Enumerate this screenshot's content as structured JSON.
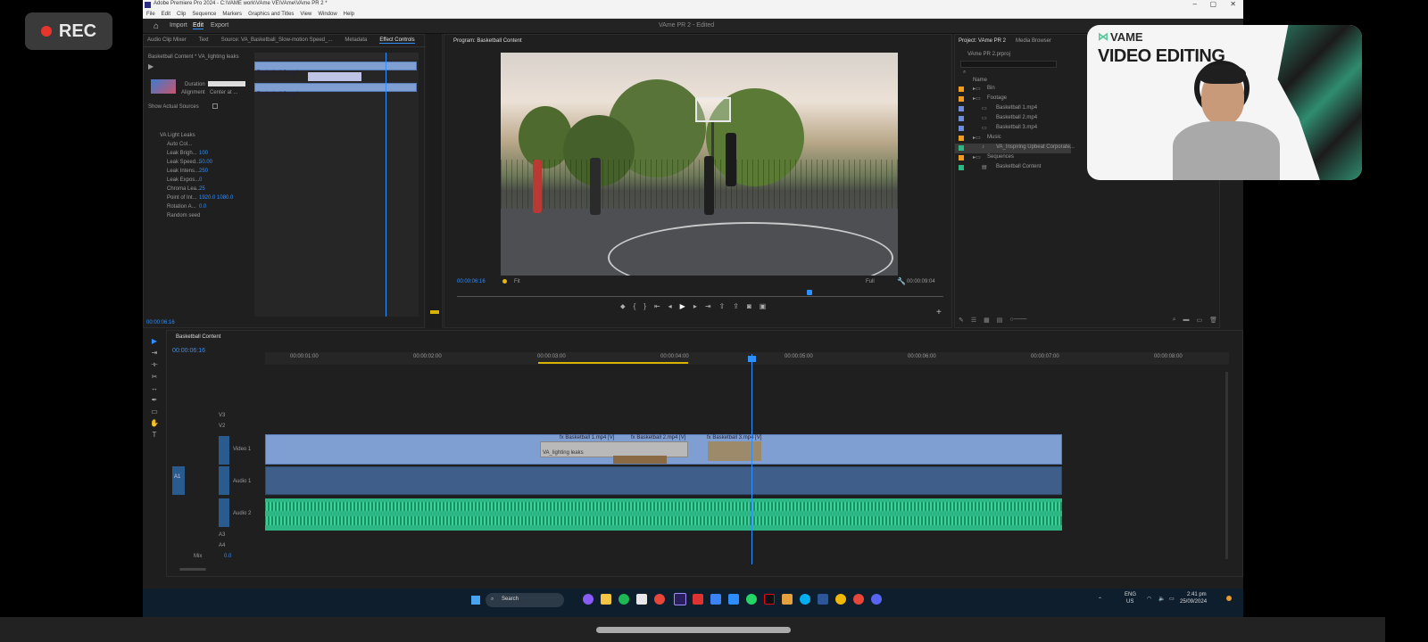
{
  "recorder": {
    "label": "REC"
  },
  "window": {
    "title": "Adobe Premiere Pro 2024 - C:\\VAME work\\VAme VE\\VAme\\VAme PR 2 *",
    "center_title": "VAme PR 2 - Edited"
  },
  "menu": [
    "File",
    "Edit",
    "Clip",
    "Sequence",
    "Markers",
    "Graphics and Titles",
    "View",
    "Window",
    "Help"
  ],
  "workspace_tabs": [
    "Import",
    "Edit",
    "Export"
  ],
  "source_tabs": [
    "Audio Clip Mixer",
    "Text",
    "Source: VA_Basketball_Slow-motion Speed_...",
    "Metadata",
    "Effect Controls"
  ],
  "effect_controls": {
    "header": "Basketball Content * VA_lighting leaks",
    "clips": [
      "Basketball 2.mp4",
      "Basketball 2.mp4"
    ],
    "duration_label": "Duration",
    "alignment_label": "Alignment",
    "alignment_value": "Center at ...",
    "show_actual_sources": "Show Actual Sources",
    "fx_title": "VA Light Leaks",
    "params": [
      {
        "name": "Auto Col...",
        "value": ""
      },
      {
        "name": "Leak Brigh...",
        "value": "100"
      },
      {
        "name": "Leak Speed...",
        "value": "50.00"
      },
      {
        "name": "Leak Intens...",
        "value": "250"
      },
      {
        "name": "Leak Expos...",
        "value": "0"
      },
      {
        "name": "Chroma Lea...",
        "value": "25"
      },
      {
        "name": "Point of Int...",
        "value": "1920.0   1080.0"
      },
      {
        "name": "Rotation A...",
        "value": "0.0"
      },
      {
        "name": "Random seed",
        "value": ""
      }
    ],
    "timecode": "00:00:06:16"
  },
  "program": {
    "tab": "Program: Basketball Content",
    "timecode": "00:00:06:16",
    "fit": "Fit",
    "quality": "Full",
    "duration": "00:00:09:04"
  },
  "project": {
    "tabs": [
      "Project: VAme PR 2",
      "Media Browser"
    ],
    "path": "VAme PR 2.prproj",
    "col_name": "Name",
    "items": [
      {
        "name": "Bin",
        "color": "#f39b1f",
        "indent": 1,
        "type": "bin"
      },
      {
        "name": "Footage",
        "color": "#f39b1f",
        "indent": 1,
        "type": "bin"
      },
      {
        "name": "Basketball 1.mp4",
        "color": "#6d8ed6",
        "indent": 2,
        "type": "clip"
      },
      {
        "name": "Basketball 2.mp4",
        "color": "#6d8ed6",
        "indent": 2,
        "type": "clip"
      },
      {
        "name": "Basketball 3.mp4",
        "color": "#6d8ed6",
        "indent": 2,
        "type": "clip"
      },
      {
        "name": "Music",
        "color": "#f39b1f",
        "indent": 1,
        "type": "bin"
      },
      {
        "name": "VA_Inspiring Upbeat Corporate...",
        "color": "#2db785",
        "indent": 2,
        "type": "audio",
        "selected": true
      },
      {
        "name": "Sequences",
        "color": "#f39b1f",
        "indent": 1,
        "type": "bin"
      },
      {
        "name": "Basketball Content",
        "color": "#2db785",
        "indent": 2,
        "type": "sequence"
      }
    ]
  },
  "overlay": {
    "brand": "VAME",
    "title": "VIDEO EDITING"
  },
  "timeline": {
    "tab": "Basketball Content",
    "timecode": "00:00:06:16",
    "ruler": [
      "00:00:01:00",
      "00:00:02:00",
      "00:00:03:00",
      "00:00:04:00",
      "00:00:05:00",
      "00:00:06:00",
      "00:00:07:00",
      "00:00:08:00"
    ],
    "tracks": [
      {
        "id": "V3",
        "name": ""
      },
      {
        "id": "V2",
        "name": ""
      },
      {
        "id": "V1",
        "name": "Video 1"
      },
      {
        "id": "A1",
        "name": "Audio 1"
      },
      {
        "id": "A2",
        "name": "Audio 2"
      },
      {
        "id": "A3",
        "name": ""
      },
      {
        "id": "A4",
        "name": ""
      }
    ],
    "mix_label": "Mix",
    "mix_value": "0.0",
    "source_patch_v": "V1",
    "source_patch_a": "A1",
    "clips": {
      "v1_labels": [
        "fx Basketball 1.mp4 [V]",
        "fx Basketball 2.mp4 [V]",
        "fx Basketball 3.mp4 [V]"
      ],
      "effect_clip": "VA_lighting leaks"
    }
  },
  "taskbar": {
    "search": "Search",
    "lang": "ENG",
    "region": "US",
    "time": "2:41 pm",
    "date": "25/09/2024"
  }
}
